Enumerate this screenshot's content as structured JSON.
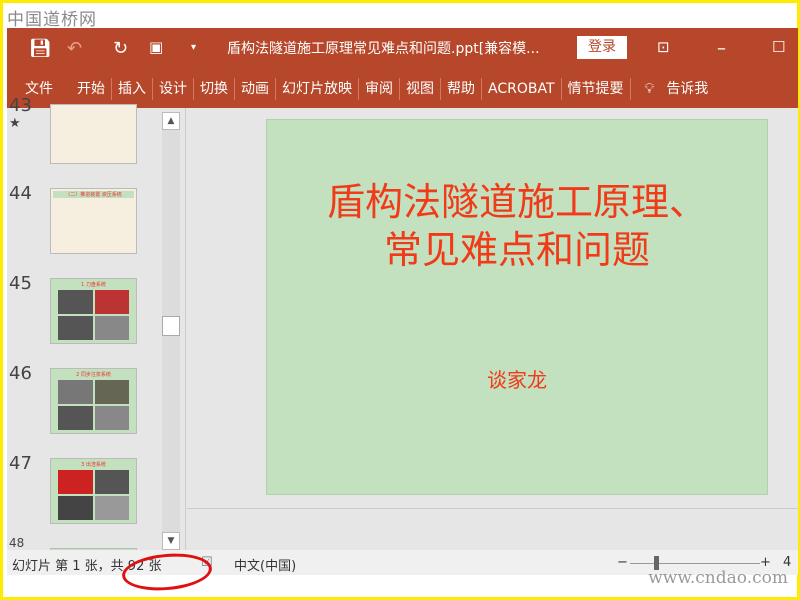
{
  "watermark_top": "中国道桥网",
  "watermark_bottom": "www.cndao.com",
  "titlebar": {
    "title": "盾构法隧道施工原理常见难点和问题.ppt[兼容模...",
    "login": "登录"
  },
  "ribbon": {
    "tabs": [
      "文件",
      "开始",
      "插入",
      "设计",
      "切换",
      "动画",
      "幻灯片放映",
      "审阅",
      "视图",
      "帮助",
      "ACROBAT",
      "情节提要"
    ],
    "tell_me": "告诉我"
  },
  "sidebar": {
    "thumbs": [
      {
        "num": "43"
      },
      {
        "num": "44",
        "title": "（二）推进装置 液压系统"
      },
      {
        "num": "45",
        "title": "1 刀盘系统"
      },
      {
        "num": "46",
        "title": "2 同步注浆系统"
      },
      {
        "num": "47",
        "title": "3 出渣系统"
      },
      {
        "num": "48"
      }
    ]
  },
  "slide": {
    "title_line1": "盾构法隧道施工原理、",
    "title_line2": "常见难点和问题",
    "subtitle": "谈家龙"
  },
  "status": {
    "slide_count": "幻灯片 第 1 张，共 92 张",
    "language": "中文(中国)",
    "zoom": "4"
  }
}
